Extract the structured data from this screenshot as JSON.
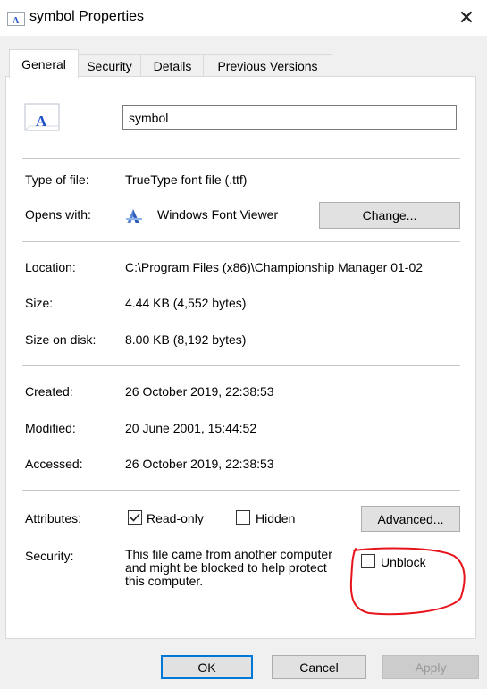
{
  "window": {
    "title": "symbol Properties",
    "close_glyph": "✕"
  },
  "tabs": [
    {
      "label": "General",
      "active": true
    },
    {
      "label": "Security",
      "active": false
    },
    {
      "label": "Details",
      "active": false
    },
    {
      "label": "Previous Versions",
      "active": false
    }
  ],
  "general": {
    "file_icon": "font-file-icon",
    "file_icon_letter": "A",
    "filename": "symbol",
    "type_of_file": {
      "label": "Type of file:",
      "value": "TrueType font file (.ttf)"
    },
    "opens_with": {
      "label": "Opens with:",
      "app": "Windows Font Viewer",
      "app_icon": "font-viewer-icon",
      "change_button": "Change..."
    },
    "location": {
      "label": "Location:",
      "value": "C:\\Program Files (x86)\\Championship Manager 01-02"
    },
    "size": {
      "label": "Size:",
      "value": "4.44 KB (4,552 bytes)"
    },
    "size_on_disk": {
      "label": "Size on disk:",
      "value": "8.00 KB (8,192 bytes)"
    },
    "created": {
      "label": "Created:",
      "value": "26 October 2019, 22:38:53"
    },
    "modified": {
      "label": "Modified:",
      "value": "20 June 2001, 15:44:52"
    },
    "accessed": {
      "label": "Accessed:",
      "value": "26 October 2019, 22:38:53"
    },
    "attributes": {
      "label": "Attributes:",
      "read_only": {
        "label": "Read-only",
        "checked": true
      },
      "hidden": {
        "label": "Hidden",
        "checked": false
      },
      "advanced_button": "Advanced..."
    },
    "security": {
      "label": "Security:",
      "text": "This file came from another computer and might be blocked to help protect this computer.",
      "unblock": {
        "label": "Unblock",
        "checked": false
      }
    }
  },
  "footer": {
    "ok": "OK",
    "cancel": "Cancel",
    "apply": "Apply"
  },
  "colors": {
    "accent": "#0078d7",
    "annotation": "#e8141c",
    "icon_blue": "#1e50c8"
  }
}
